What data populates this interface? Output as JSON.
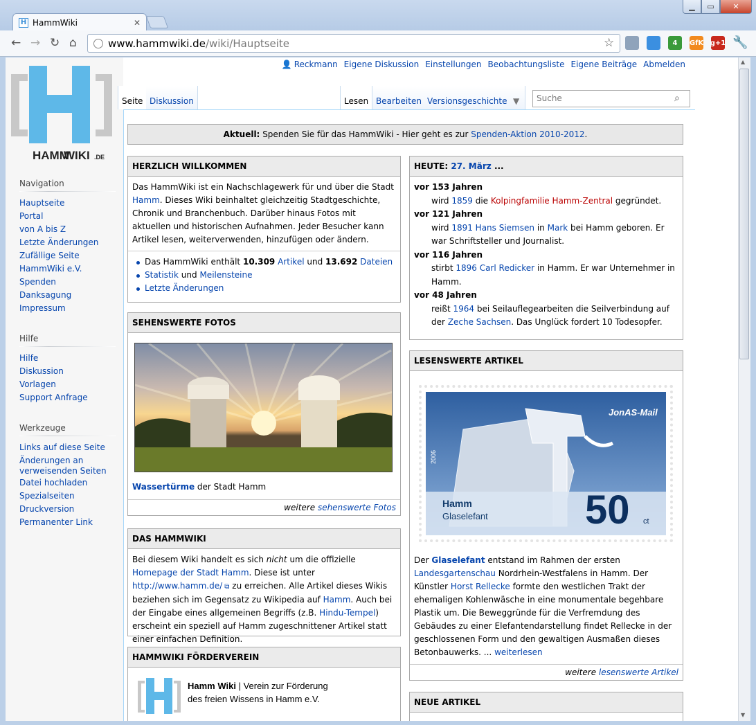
{
  "browser": {
    "tab_title": "HammWiki",
    "tab_favicon": "H",
    "url_host": "www.hammwiki.de",
    "url_path": "/wiki/Hauptseite",
    "extensions": [
      {
        "name": "weather-extension-icon",
        "label": "",
        "color": "#8fa3bb"
      },
      {
        "name": "dropbox-extension-icon",
        "label": "",
        "color": "#3b8fe0"
      },
      {
        "name": "counter-extension-icon",
        "label": "4",
        "color": "#3a9a3a"
      },
      {
        "name": "gfk-extension-icon",
        "label": "GfK",
        "color": "#f28a1e"
      },
      {
        "name": "google-plus-extension-icon",
        "label": "g+1",
        "color": "#c8281c"
      }
    ]
  },
  "wiki": {
    "logo_text_bold": "HAMM",
    "logo_text_rest": "WIKI",
    "logo_suffix": ".DE",
    "personal": {
      "user": "Reckmann",
      "links": [
        "Eigene Diskussion",
        "Einstellungen",
        "Beobachtungsliste",
        "Eigene Beiträge",
        "Abmelden"
      ]
    },
    "tabs_left": [
      "Seite",
      "Diskussion"
    ],
    "tabs_right": [
      "Lesen",
      "Bearbeiten",
      "Versionsgeschichte"
    ],
    "search_placeholder": "Suche",
    "navigation": {
      "heading": "Navigation",
      "items": [
        "Hauptseite",
        "Portal",
        "von A bis Z",
        "Letzte Änderungen",
        "Zufällige Seite",
        "HammWiki e.V.",
        "Spenden",
        "Danksagung",
        "Impressum"
      ]
    },
    "hilfe": {
      "heading": "Hilfe",
      "items": [
        "Hilfe",
        "Diskussion",
        "Vorlagen",
        "Support Anfrage"
      ]
    },
    "werkzeuge": {
      "heading": "Werkzeuge",
      "items": [
        "Links auf diese Seite",
        "Änderungen an verweisenden Seiten",
        "Datei hochladen",
        "Spezialseiten",
        "Druckversion",
        "Permanenter Link"
      ]
    },
    "aktuell": {
      "label": "Aktuell:",
      "text": "Spenden Sie für das HammWiki - Hier geht es zur",
      "link": "Spenden-Aktion 2010-2012",
      "end": "."
    },
    "welcome": {
      "title": "HERZLICH WILLKOMMEN",
      "p1": "Das HammWiki ist ein Nachschlagewerk für und über die Stadt",
      "p1_link": "Hamm",
      "p1_rest": ". Dieses Wiki beinhaltet gleichzeitig Stadtgeschichte, Chronik und Branchenbuch. Darüber hinaus Fotos mit aktuellen und historischen Aufnahmen. Jeder Besucher kann Artikel lesen, weiterverwenden, hinzufügen oder ändern.",
      "stats_pre": "Das HammWiki enthält",
      "articles_count": "10.309",
      "articles_link": "Artikel",
      "and": "und",
      "files_count": "13.692",
      "files_link": "Dateien",
      "stat_link": "Statistik",
      "stat_and": "und",
      "milestones_link": "Meilensteine",
      "recent_link": "Letzte Änderungen"
    },
    "photos": {
      "title": "SEHENSWERTE FOTOS",
      "caption_link": "Wassertürme",
      "caption_rest": "der Stadt Hamm",
      "more_pre": "weitere",
      "more_link": "sehenswerte Fotos"
    },
    "hammwiki": {
      "title": "DAS HAMMWIKI",
      "t1": "Bei diesem Wiki handelt es sich",
      "t_nicht": "nicht",
      "t2": "um die offizielle",
      "l_home": "Homepage der Stadt Hamm",
      "t3": ". Diese ist unter",
      "l_url": "http://www.hamm.de/",
      "t4": "zu erreichen. Alle Artikel dieses Wikis beziehen sich im Gegensatz zu Wikipedia auf",
      "l_hamm": "Hamm",
      "t5": ". Auch bei der Eingabe eines allgemeinen Begriffs (z.B.",
      "l_hindu": "Hindu-Tempel",
      "t6": ") erscheint ein speziell auf Hamm zugeschnittener Artikel statt einer einfachen Definition."
    },
    "verein": {
      "title": "HAMMWIKI FÖRDERVEREIN",
      "name": "Hamm Wiki",
      "sep": "| Verein zur Förderung",
      "line2": "des freien Wissens in Hamm e.V."
    },
    "heute": {
      "title_pre": "HEUTE:",
      "date_link": "27. März",
      "title_post": "...",
      "entries": [
        {
          "ago": "vor 153 Jahren",
          "a": "wird",
          "l1": "1859",
          "b": "die",
          "l2": "Kolpingfamilie Hamm-Zentral",
          "c": "gegründet.",
          "d": "",
          "e": ""
        },
        {
          "ago": "vor 121 Jahren",
          "a": "wird",
          "l1": "1891 Hans Siemsen",
          "b": "in",
          "l2": "Mark",
          "c": "bei Hamm geboren. Er war Schriftsteller und Journalist.",
          "d": "",
          "e": ""
        },
        {
          "ago": "vor 116 Jahren",
          "a": "stirbt",
          "l1": "1896 Carl Redicker",
          "b": "in Hamm. Er war Unternehmer in Hamm.",
          "l2": "",
          "c": "",
          "d": "",
          "e": ""
        },
        {
          "ago": "vor 48 Jahren",
          "a": "reißt",
          "l1": "1964",
          "b": "bei Seilauflegearbeiten die Seilverbindung auf der",
          "l2": "Zeche Sachsen",
          "c": ". Das Unglück fordert 10 Todesopfer.",
          "d": "",
          "e": ""
        }
      ]
    },
    "lesenswert": {
      "title": "LESENSWERTE ARTIKEL",
      "stamp_brand": "JonAS-Mail",
      "stamp_year": "2006",
      "stamp_city": "Hamm",
      "stamp_name": "Glaselefant",
      "stamp_value": "50",
      "stamp_unit": "ct",
      "t1": "Der",
      "l1": "Glaselefant",
      "t2": "entstand im Rahmen der ersten",
      "l2": "Landesgartenschau",
      "t3": "Nordrhein-Westfalens in Hamm. Der Künstler",
      "l3": "Horst Rellecke",
      "t4": "formte den westlichen Trakt der ehemaligen Kohlenwäsche in eine monumentale begehbare Plastik um. Die Beweggründe für die Verfremdung des Gebäudes zu einer Elefantendarstellung findet Rellecke in der geschlossenen Form und den gewaltigen Ausmaßen dieses Betonbauwerks. ...",
      "l4": "weiterlesen",
      "more_pre": "weitere",
      "more_link": "lesenswerte Artikel"
    },
    "neue": {
      "title": "NEUE ARTIKEL"
    }
  }
}
